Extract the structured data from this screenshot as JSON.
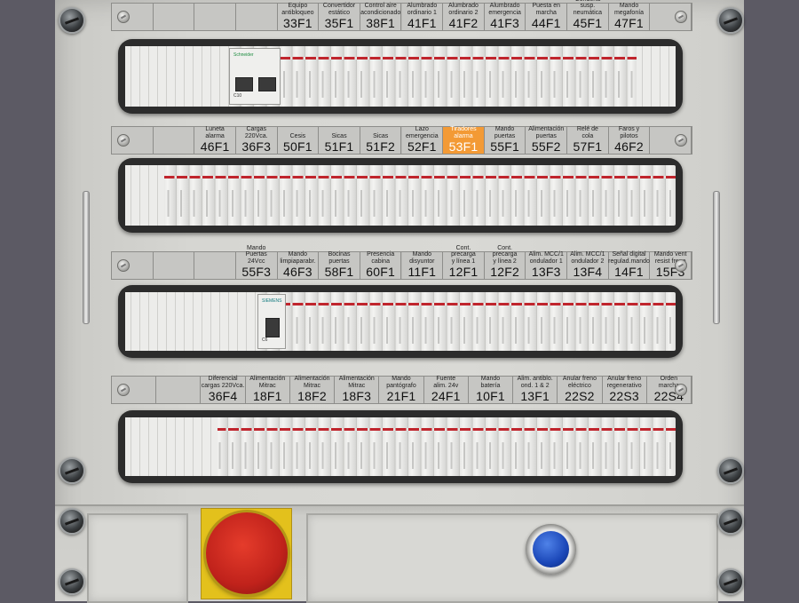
{
  "label_strips": [
    {
      "cells": [
        {
          "desc": "",
          "code": ""
        },
        {
          "desc": "",
          "code": ""
        },
        {
          "desc": "",
          "code": ""
        },
        {
          "desc": "",
          "code": ""
        },
        {
          "desc": "Equipo\nantibloqueo",
          "code": "33F1"
        },
        {
          "desc": "Convertidor\nestático",
          "code": "35F1"
        },
        {
          "desc": "Control aire\nacondicionado",
          "code": "38F1"
        },
        {
          "desc": "Alumbrado\nordinario 1",
          "code": "41F1"
        },
        {
          "desc": "Alumbrado\nordinario 2",
          "code": "41F2"
        },
        {
          "desc": "Alumbrado\nemergencia",
          "code": "41F3"
        },
        {
          "desc": "Puesta en\nmarcha",
          "code": "44F1"
        },
        {
          "desc": "Condena susp.\nneumática",
          "code": "45F1"
        },
        {
          "desc": "Mando\nmegafonía",
          "code": "47F1"
        },
        {
          "desc": "",
          "code": ""
        }
      ]
    },
    {
      "cells": [
        {
          "desc": "",
          "code": ""
        },
        {
          "desc": "",
          "code": ""
        },
        {
          "desc": "Luneta\nalarma",
          "code": "46F1"
        },
        {
          "desc": "Cargas\n220Vca.",
          "code": "36F3"
        },
        {
          "desc": "Cesis",
          "code": "50F1"
        },
        {
          "desc": "Sicas",
          "code": "51F1"
        },
        {
          "desc": "Sicas",
          "code": "51F2"
        },
        {
          "desc": "Lazo\nemergencia",
          "code": "52F1"
        },
        {
          "desc": "Tiradores\nalarma",
          "code": "53F1",
          "highlight": true
        },
        {
          "desc": "Mando\npuertas",
          "code": "55F1"
        },
        {
          "desc": "Alimentación\npuertas",
          "code": "55F2"
        },
        {
          "desc": "Relé de\ncola",
          "code": "57F1"
        },
        {
          "desc": "Faros y\npilotos",
          "code": "46F2"
        },
        {
          "desc": "",
          "code": ""
        }
      ]
    },
    {
      "cells": [
        {
          "desc": "",
          "code": ""
        },
        {
          "desc": "",
          "code": ""
        },
        {
          "desc": "",
          "code": ""
        },
        {
          "desc": "Mando Puertas\n24Vcc",
          "code": "55F3"
        },
        {
          "desc": "Mando\nlimpiaparabr.",
          "code": "46F3"
        },
        {
          "desc": "Bocinas\npuertas",
          "code": "58F1"
        },
        {
          "desc": "Presencia\ncabina",
          "code": "60F1"
        },
        {
          "desc": "Mando\ndisyuntor",
          "code": "11F1"
        },
        {
          "desc": "Cont. precarga\ny línea 1",
          "code": "12F1"
        },
        {
          "desc": "Cont. precarga\ny línea 2",
          "code": "12F2"
        },
        {
          "desc": "Alim. MCC/1\nondulador 1",
          "code": "13F3"
        },
        {
          "desc": "Alim. MCC/1\nondulador 2",
          "code": "13F4"
        },
        {
          "desc": "Señal digital\nregulad.mando",
          "code": "14F1"
        },
        {
          "desc": "Mando vent\nresist freno",
          "code": "15F3"
        }
      ]
    },
    {
      "cells": [
        {
          "desc": "",
          "code": ""
        },
        {
          "desc": "",
          "code": ""
        },
        {
          "desc": "Diferencial\ncargas 220Vca.",
          "code": "36F4"
        },
        {
          "desc": "Alimentación\nMitrac",
          "code": "18F1"
        },
        {
          "desc": "Alimentación\nMitrac",
          "code": "18F2"
        },
        {
          "desc": "Alimentación\nMitrac",
          "code": "18F3"
        },
        {
          "desc": "Mando\npantógrafo",
          "code": "21F1"
        },
        {
          "desc": "Fuente\nalim. 24v",
          "code": "24F1"
        },
        {
          "desc": "Mando\nbatería",
          "code": "10F1"
        },
        {
          "desc": "Alim. antiblo.\nond. 1 & 2",
          "code": "13F1"
        },
        {
          "desc": "Anular freno\neléctrico",
          "code": "22S2"
        },
        {
          "desc": "Anular freno\nregenerativo",
          "code": "22S3"
        },
        {
          "desc": "Orden\nmarcha",
          "code": "22S4"
        }
      ]
    }
  ],
  "breakers": {
    "schneider": {
      "brand": "Schneider",
      "rating": "C10"
    },
    "siemens": {
      "brand": "SIEMENS",
      "rating": "C6"
    }
  },
  "controls": {
    "emergency_stop": {
      "color": "#c0221b"
    },
    "blue_button": {
      "color": "#1b47b8"
    }
  },
  "colors": {
    "highlight": "#f39a35",
    "abb_red": "#c0252d"
  }
}
